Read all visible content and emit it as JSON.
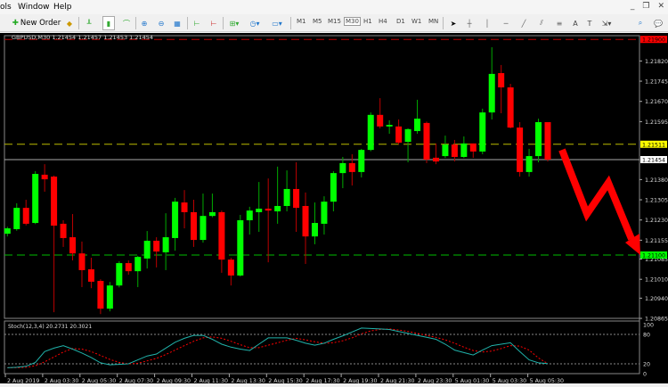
{
  "menu": {
    "items": [
      "ols",
      "Window",
      "Help"
    ]
  },
  "window_controls": {
    "minimize": "_",
    "restore": "❐",
    "close": "✕"
  },
  "toolbar": {
    "new_order_label": "New Order",
    "timeframes": [
      "M1",
      "M5",
      "M15",
      "M30",
      "H1",
      "H4",
      "D1",
      "W1",
      "MN"
    ],
    "active_timeframe": "M30"
  },
  "chart": {
    "title": "GBPUSD,M30  1.21454 1.21457 1.21453 1.21454",
    "price_ticks": [
      "1.21820",
      "1.21745",
      "1.21670",
      "1.21595",
      "1.21380",
      "1.21305",
      "1.21230",
      "1.21155",
      "1.21085",
      "1.21010",
      "1.20940",
      "1.20865"
    ],
    "price_tick_values": [
      1.2182,
      1.21745,
      1.2167,
      1.21595,
      1.2138,
      1.21305,
      1.2123,
      1.21155,
      1.21085,
      1.2101,
      1.2094,
      1.20865
    ],
    "levels": [
      {
        "label": "1.21900",
        "value": 1.219,
        "color": "#ff0000",
        "style": "dashed"
      },
      {
        "label": "1.21511",
        "value": 1.21511,
        "color": "#ffff00",
        "style": "dashed"
      },
      {
        "label": "1.21454",
        "value": 1.21454,
        "color": "#ffffff",
        "style": "solid-bid"
      },
      {
        "label": "1.21100",
        "value": 1.211,
        "color": "#00ff00",
        "style": "dashed"
      }
    ],
    "bull_color": "#00ff00",
    "bear_color": "#ff0000",
    "annotation": "red-zigzag-down-arrow",
    "time_labels": [
      "2 Aug 2019",
      "2 Aug 03:30",
      "2 Aug 05:30",
      "2 Aug 07:30",
      "2 Aug 09:30",
      "2 Aug 11:30",
      "2 Aug 13:30",
      "2 Aug 15:30",
      "2 Aug 17:30",
      "2 Aug 19:30",
      "2 Aug 21:30",
      "2 Aug 23:30",
      "5 Aug 01:30",
      "5 Aug 03:30",
      "5 Aug 05:30"
    ]
  },
  "stoch": {
    "title": "Stoch(12,3,4) 20.2731 20.3021",
    "levels": [
      "100",
      "80",
      "20",
      "0"
    ],
    "main_color": "#20b2aa",
    "signal_color": "#ff0000"
  },
  "chart_data": {
    "type": "candlestick",
    "symbol": "GBPUSD",
    "timeframe": "M30",
    "ylim": [
      1.20865,
      1.219
    ],
    "ohlc": [
      [
        1.21179,
        1.21205,
        1.21169,
        1.21199
      ],
      [
        1.21196,
        1.21292,
        1.2119,
        1.21275
      ],
      [
        1.21275,
        1.21305,
        1.2121,
        1.21216
      ],
      [
        1.21219,
        1.21411,
        1.21215,
        1.21401
      ],
      [
        1.21398,
        1.21437,
        1.21335,
        1.21381
      ],
      [
        1.21391,
        1.21395,
        1.20888,
        1.21209
      ],
      [
        1.21216,
        1.21229,
        1.2113,
        1.21163
      ],
      [
        1.21166,
        1.21252,
        1.2108,
        1.21106
      ],
      [
        1.21106,
        1.2115,
        1.20981,
        1.21044
      ],
      [
        1.21047,
        1.2109,
        1.20977,
        1.21001
      ],
      [
        1.21004,
        1.2101,
        1.20881,
        1.20901
      ],
      [
        1.20901,
        1.21,
        1.20891,
        1.20987
      ],
      [
        1.20987,
        1.21077,
        1.2098,
        1.2107
      ],
      [
        1.2107,
        1.2108,
        1.21027,
        1.2104
      ],
      [
        1.2104,
        1.21097,
        1.20981,
        1.21093
      ],
      [
        1.21087,
        1.21189,
        1.2105,
        1.21153
      ],
      [
        1.21153,
        1.21166,
        1.21054,
        1.21113
      ],
      [
        1.2111,
        1.21255,
        1.21044,
        1.21166
      ],
      [
        1.21163,
        1.21312,
        1.21116,
        1.21298
      ],
      [
        1.21295,
        1.21341,
        1.21199,
        1.21259
      ],
      [
        1.21259,
        1.21305,
        1.2113,
        1.21156
      ],
      [
        1.21156,
        1.21328,
        1.21146,
        1.21245
      ],
      [
        1.21245,
        1.21328,
        1.2124,
        1.21259
      ],
      [
        1.21259,
        1.21265,
        1.21034,
        1.21083
      ],
      [
        1.21083,
        1.2109,
        1.20987,
        1.21024
      ],
      [
        1.21024,
        1.21249,
        1.2102,
        1.21229
      ],
      [
        1.21229,
        1.21279,
        1.21176,
        1.21265
      ],
      [
        1.21259,
        1.21371,
        1.21186,
        1.21272
      ],
      [
        1.21272,
        1.21384,
        1.21073,
        1.21265
      ],
      [
        1.21262,
        1.21428,
        1.21216,
        1.21282
      ],
      [
        1.21282,
        1.21414,
        1.21262,
        1.21345
      ],
      [
        1.21345,
        1.21444,
        1.21186,
        1.21275
      ],
      [
        1.21282,
        1.21332,
        1.21067,
        1.21169
      ],
      [
        1.21169,
        1.21295,
        1.2114,
        1.21219
      ],
      [
        1.21216,
        1.21318,
        1.21176,
        1.21298
      ],
      [
        1.21298,
        1.21411,
        1.21262,
        1.21404
      ],
      [
        1.21404,
        1.21464,
        1.21348,
        1.21441
      ],
      [
        1.21441,
        1.21474,
        1.21358,
        1.21408
      ],
      [
        1.21408,
        1.21494,
        1.21388,
        1.2149
      ],
      [
        1.2149,
        1.21629,
        1.21485,
        1.2162
      ],
      [
        1.2162,
        1.21682,
        1.2157,
        1.21577
      ],
      [
        1.21577,
        1.216,
        1.2155,
        1.21583
      ],
      [
        1.21577,
        1.21603,
        1.2151,
        1.21517
      ],
      [
        1.2152,
        1.2157,
        1.21444,
        1.21567
      ],
      [
        1.2156,
        1.21676,
        1.2155,
        1.21606
      ],
      [
        1.2159,
        1.21595,
        1.21441,
        1.21454
      ],
      [
        1.21461,
        1.21514,
        1.21437,
        1.21447
      ],
      [
        1.21467,
        1.21543,
        1.2146,
        1.2151
      ],
      [
        1.2151,
        1.21527,
        1.21447,
        1.21464
      ],
      [
        1.21464,
        1.2154,
        1.2146,
        1.21514
      ],
      [
        1.21514,
        1.21514,
        1.21461,
        1.21484
      ],
      [
        1.21484,
        1.21643,
        1.21474,
        1.21629
      ],
      [
        1.21629,
        1.21871,
        1.21603,
        1.21772
      ],
      [
        1.21775,
        1.21805,
        1.21626,
        1.21722
      ],
      [
        1.21722,
        1.21735,
        1.2157,
        1.21573
      ],
      [
        1.21573,
        1.21593,
        1.21391,
        1.21408
      ],
      [
        1.21408,
        1.21494,
        1.21391,
        1.21467
      ],
      [
        1.21467,
        1.21606,
        1.21444,
        1.21593
      ],
      [
        1.21593,
        1.21593,
        1.21447,
        1.21454
      ]
    ],
    "stoch_main": [
      12,
      13,
      15,
      23,
      45,
      52,
      57,
      50,
      42,
      33,
      22,
      18,
      19,
      20,
      28,
      36,
      40,
      52,
      64,
      72,
      78,
      78,
      70,
      60,
      54,
      50,
      47,
      60,
      73,
      73,
      73,
      68,
      62,
      58,
      62,
      70,
      77,
      85,
      93,
      92,
      91,
      90,
      86,
      82,
      78,
      74,
      70,
      60,
      48,
      43,
      38,
      48,
      57,
      60,
      63,
      45,
      28,
      22,
      20.2731
    ],
    "stoch_signal": [
      12,
      12,
      13,
      16,
      24,
      34,
      44,
      51,
      50,
      45,
      37,
      29,
      23,
      20,
      21,
      26,
      31,
      39,
      48,
      57,
      66,
      73,
      75,
      72,
      66,
      59,
      53,
      53,
      58,
      63,
      68,
      72,
      69,
      65,
      62,
      63,
      67,
      73,
      81,
      87,
      90,
      91,
      89,
      86,
      82,
      78,
      74,
      69,
      62,
      54,
      47,
      44,
      46,
      51,
      57,
      56,
      48,
      32,
      20.3021
    ],
    "stoch_ylim": [
      0,
      100
    ]
  }
}
